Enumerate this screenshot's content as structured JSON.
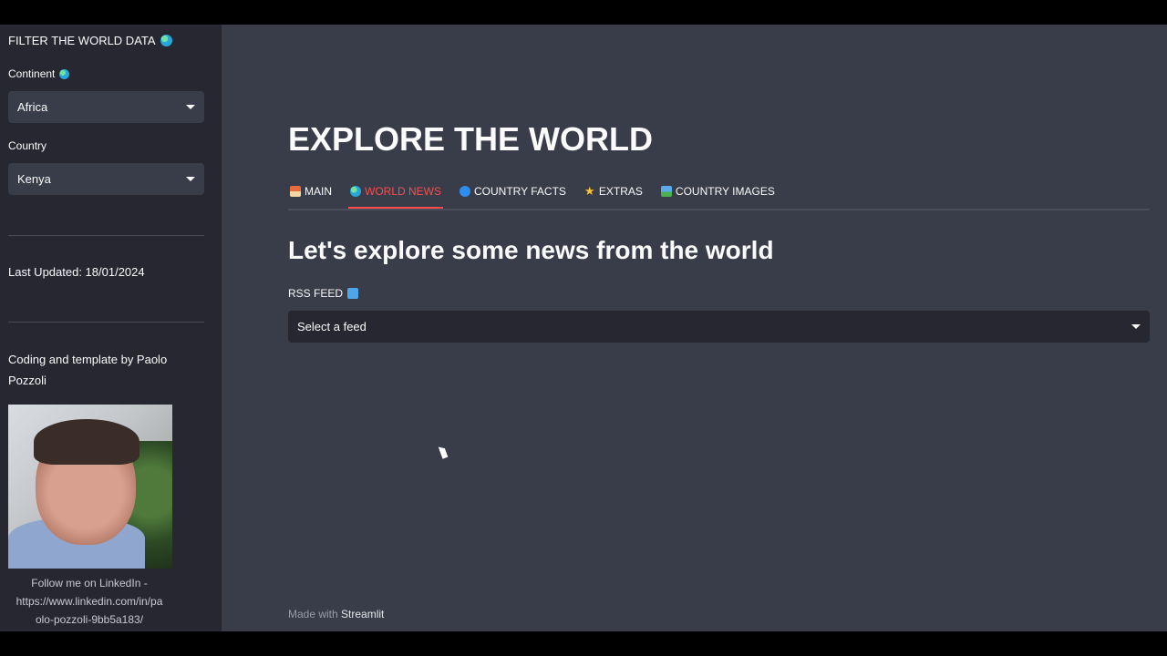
{
  "sidebar": {
    "title": "FILTER THE WORLD DATA",
    "title_icon": "globe-icon",
    "continent_label": "Continent",
    "continent_value": "Africa",
    "country_label": "Country",
    "country_value": "Kenya",
    "last_updated": "Last Updated: 18/01/2024",
    "credit": "Coding and template by Paolo Pozzoli",
    "follow_line1": "Follow me on LinkedIn -",
    "follow_line2": "https://www.linkedin.com/in/pa",
    "follow_line3": "olo-pozzoli-9bb5a183/"
  },
  "main": {
    "title": "EXPLORE THE WORLD",
    "tabs": [
      {
        "label": "MAIN",
        "icon": "house-icon"
      },
      {
        "label": "WORLD NEWS",
        "icon": "globe-icon",
        "active": true
      },
      {
        "label": "COUNTRY FACTS",
        "icon": "search-icon"
      },
      {
        "label": "EXTRAS",
        "icon": "star-icon"
      },
      {
        "label": "COUNTRY IMAGES",
        "icon": "image-icon"
      }
    ],
    "subtitle": "Let's explore some news from the world",
    "rss_label": "RSS FEED",
    "feed_placeholder": "Select a feed",
    "footer_prefix": "Made with",
    "footer_brand": "Streamlit"
  },
  "colors": {
    "sidebar_bg": "#262730",
    "main_bg": "#393c49",
    "accent": "#ff4b4b"
  }
}
